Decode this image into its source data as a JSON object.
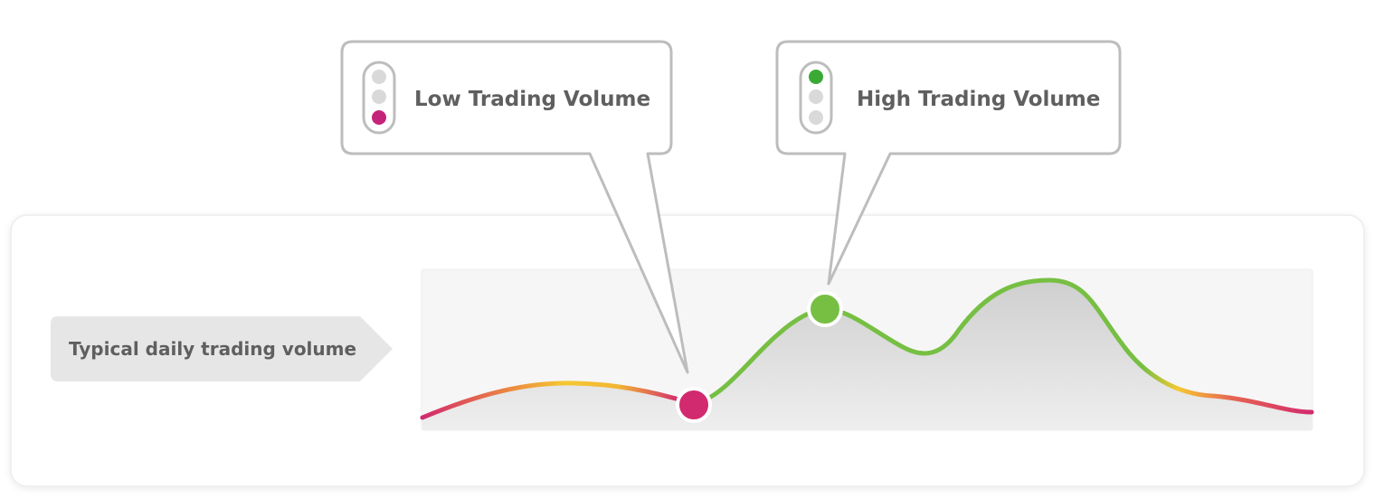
{
  "row_label": "Typical daily trading volume",
  "callouts": [
    {
      "text": "Low Trading Volume",
      "level": "low",
      "light_colors": [
        "#d9d9d9",
        "#d9d9d9",
        "#c4237a"
      ]
    },
    {
      "text": "High Trading Volume",
      "level": "high",
      "light_colors": [
        "#3aaa35",
        "#d9d9d9",
        "#d9d9d9"
      ]
    }
  ],
  "colors": {
    "low": "#d22a6e",
    "medium": "#f2c230",
    "high": "#76bf43",
    "text": "#5f5f5f",
    "callout_border": "#bdbdbd"
  }
}
